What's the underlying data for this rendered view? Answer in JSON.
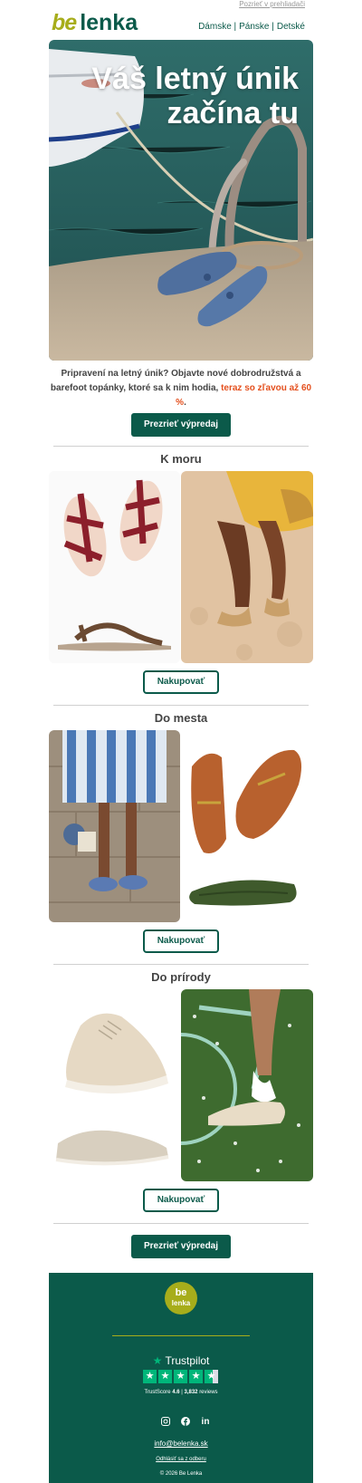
{
  "header": {
    "view_in_browser": "Pozrieť v prehliadači",
    "logo_be": "be",
    "logo_lenka": "lenka",
    "nav": [
      "Dámske |",
      "Pánske |",
      "Detské"
    ]
  },
  "hero": {
    "title_line1": "Váš letný únik",
    "title_line2": "začína tu",
    "image": "loafers-on-pier-photo"
  },
  "intro": {
    "text_before": "Pripravení na letný únik? Objavte nové dobrodružstvá a barefoot topánky, ktoré sa k nim hodia,",
    "highlight": "teraz so zľavou až 60 %",
    "text_after": "."
  },
  "cta_top": "Prezrieť výpredaj",
  "sections": [
    {
      "title": "K moru",
      "button": "Nakupovať"
    },
    {
      "title": "Do mesta",
      "button": "Nakupovať"
    },
    {
      "title": "Do prírody",
      "button": "Nakupovať"
    }
  ],
  "cta_bottom": "Prezrieť výpredaj",
  "footer": {
    "logo_be": "be",
    "logo_lenka": "lenka",
    "trustpilot": "Trustpilot",
    "trustscore_label": "TrustScore",
    "trustscore_value": "4.6",
    "reviews_count": "3,832",
    "reviews_label": "reviews",
    "email": "info@belenka.sk",
    "unsubscribe": "Odhlásiť sa z odberu",
    "copyright": "© 2026 Be Lenka"
  },
  "colors": {
    "brand_green": "#0b5a4a",
    "brand_olive": "#a7ad1b",
    "highlight_orange": "#e4501e",
    "trustpilot_green": "#00b67a"
  }
}
